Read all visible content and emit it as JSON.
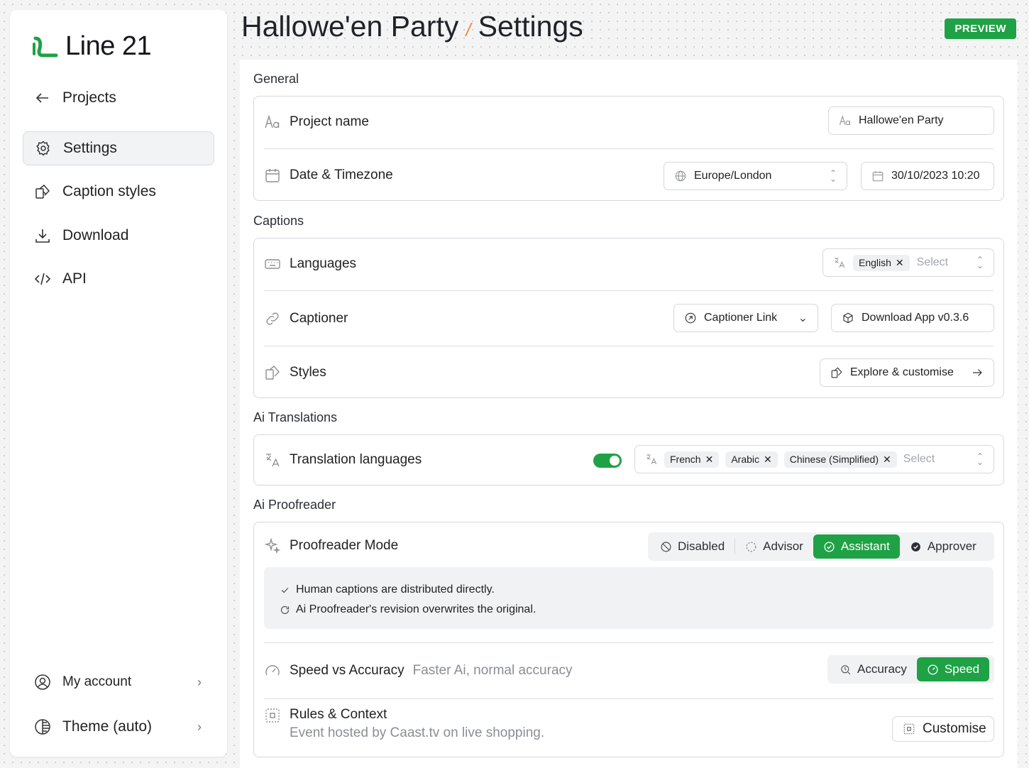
{
  "app": {
    "name": "Line 21"
  },
  "sidebar": {
    "items": [
      {
        "label": "Projects",
        "icon": "arrow-left-icon"
      },
      {
        "label": "Settings",
        "icon": "gear-icon",
        "active": true
      },
      {
        "label": "Caption styles",
        "icon": "styles-icon"
      },
      {
        "label": "Download",
        "icon": "download-icon"
      },
      {
        "label": "API",
        "icon": "code-icon"
      }
    ],
    "footer": [
      {
        "label": "My account",
        "icon": "user-circle-icon"
      },
      {
        "label": "Theme (auto)",
        "icon": "theme-icon"
      }
    ]
  },
  "header": {
    "project": "Hallowe'en Party",
    "separator": "/",
    "page": "Settings",
    "badge": "PREVIEW"
  },
  "general": {
    "title": "General",
    "project_name_label": "Project name",
    "project_name_value": "Hallowe'en Party",
    "date_label": "Date & Timezone",
    "timezone": "Europe/London",
    "datetime": "30/10/2023 10:20"
  },
  "captions": {
    "title": "Captions",
    "languages_label": "Languages",
    "languages_tags": [
      "English"
    ],
    "select_placeholder": "Select",
    "captioner_label": "Captioner",
    "captioner_link": "Captioner Link",
    "download_app": "Download App v0.3.6",
    "styles_label": "Styles",
    "explore": "Explore & customise"
  },
  "translations": {
    "title": "Ai Translations",
    "label": "Translation languages",
    "enabled": true,
    "tags": [
      "French",
      "Arabic",
      "Chinese (Simplified)"
    ],
    "select_placeholder": "Select"
  },
  "proofreader": {
    "title": "Ai Proofreader",
    "mode_label": "Proofreader Mode",
    "modes": [
      "Disabled",
      "Advisor",
      "Assistant",
      "Approver"
    ],
    "active_mode": "Assistant",
    "note_lines": [
      "Human captions are distributed directly.",
      "Ai Proofreader's revision overwrites the original."
    ],
    "speed_label": "Speed vs Accuracy",
    "speed_hint": "Faster Ai, normal accuracy",
    "speed_options": [
      "Accuracy",
      "Speed"
    ],
    "speed_active": "Speed",
    "rules_label": "Rules & Context",
    "rules_hint": "Event hosted by Caast.tv on live shopping.",
    "customise": "Customise"
  },
  "colors": {
    "accent": "#1ea245",
    "separator": "#f08c3a"
  }
}
